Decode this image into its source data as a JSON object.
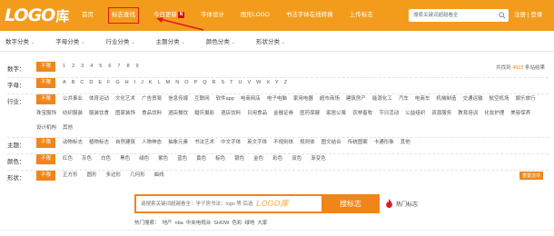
{
  "header": {
    "logo_text": "LOGO",
    "logo_suffix": "库",
    "nav": [
      {
        "label": "首页"
      },
      {
        "label": "标志查找",
        "highlighted": true
      },
      {
        "label": "今日更新",
        "badge": "N"
      },
      {
        "label": "字体设计"
      },
      {
        "label": "图形LOGO"
      },
      {
        "label": "书法字体在线转换"
      },
      {
        "label": "上传标志"
      }
    ],
    "search_placeholder": "搜索关键词超越看全",
    "login": "注册",
    "register": "登录"
  },
  "categories": [
    "数字分类",
    "字母分类",
    "行业分类",
    "主题分类",
    "颜色分类",
    "形状分类"
  ],
  "filters": {
    "nolimit": "不限",
    "number": {
      "label": "数字：",
      "values": [
        "1",
        "2",
        "3",
        "4",
        "5",
        "6",
        "7",
        "8",
        "9"
      ],
      "total_prefix": "共找到",
      "total": "4923",
      "total_suffix": "条站结果"
    },
    "letter": {
      "label": "字母：",
      "values": [
        "A",
        "B",
        "C",
        "D",
        "E",
        "F",
        "G",
        "H",
        "I",
        "J",
        "K",
        "L",
        "M",
        "N",
        "O",
        "P",
        "Q",
        "R",
        "S",
        "T",
        "U",
        "V",
        "W",
        "X",
        "Y",
        "Z"
      ]
    },
    "industry": {
      "label": "行业：",
      "values": [
        "公共事业",
        "体育运动",
        "文化艺术",
        "广告贸易",
        "信息传媒",
        "互联网",
        "软件app",
        "电商网店",
        "电子电脑",
        "家用电器",
        "超市商场",
        "建筑房产",
        "能源化工",
        "汽车",
        "电商车",
        "机械制造",
        "交通运输",
        "航空机场",
        "娱乐旅行",
        "珠宝服饰",
        "纺织服装",
        "服装饮食",
        "图家装饰",
        "食品饮料",
        "酒店餐饮",
        "婚庆摄影",
        "酒店饮料",
        "日用食品",
        "金融证券",
        "医药保健",
        "家居公寓",
        "农林畜牧",
        "节日活动",
        "公益组织",
        "资源服务",
        "教育培训",
        "化妆护理",
        "美容保养",
        "设计机构",
        "其他"
      ]
    },
    "theme": {
      "label": "主题：",
      "values": [
        "动物标志",
        "植物标志",
        "自然建筑",
        "人物神态",
        "抽象元素",
        "书法艺术",
        "中文字体",
        "英文字体",
        "不规则体",
        "规则体",
        "图文结合",
        "传统图案",
        "卡通形象",
        "其他"
      ]
    },
    "color": {
      "label": "颜色：",
      "values": [
        "红色",
        "灰色",
        "白色",
        "黑色",
        "绿色",
        "紫色",
        "蓝色",
        "黄色",
        "棕色",
        "银色",
        "金色",
        "彩色",
        "双色",
        "渐变色"
      ]
    },
    "shape": {
      "label": "形状：",
      "values": [
        "正方形",
        "圆形",
        "多边形",
        "几何形",
        "曲线"
      ],
      "reset": "重置选项"
    }
  },
  "search": {
    "placeholder": "请搜索关键词超越看全：学子房书法：logo 等 后选",
    "watermark": "LOGO库",
    "button": "搜标志",
    "hot_link": "热门标志",
    "hot_prefix": "热门搜索：",
    "hot_words": [
      "地产",
      "nba",
      "中央电视台",
      "SHOW",
      "色彩",
      "绿地",
      "大家"
    ]
  },
  "colors": {
    "accent": "#f08519",
    "header": "#f39c1b",
    "highlight": "#e0191b"
  }
}
